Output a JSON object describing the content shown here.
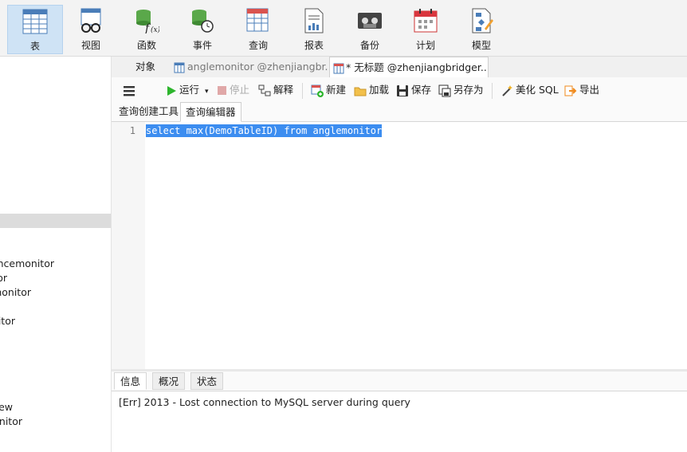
{
  "toolbar": {
    "buttons": [
      {
        "label": "表",
        "icon": "table-icon"
      },
      {
        "label": "视图",
        "icon": "view-icon"
      },
      {
        "label": "函数",
        "icon": "function-icon"
      },
      {
        "label": "事件",
        "icon": "event-icon"
      },
      {
        "label": "查询",
        "icon": "query-icon"
      },
      {
        "label": "报表",
        "icon": "report-icon"
      },
      {
        "label": "备份",
        "icon": "backup-icon"
      },
      {
        "label": "计划",
        "icon": "schedule-icon"
      },
      {
        "label": "模型",
        "icon": "model-icon"
      }
    ]
  },
  "left_pane": {
    "items": [
      "ncemonitor",
      "or",
      "monitor",
      "itor",
      "ew",
      "nitor"
    ]
  },
  "tabs": [
    "对象",
    "anglemonitor @zhenjiangbr...",
    "* 无标题 @zhenjiangbridger..."
  ],
  "query_toolbar": {
    "run": "运行",
    "stop": "停止",
    "explain": "解释",
    "new": "新建",
    "load": "加载",
    "save": "保存",
    "save_as": "另存为",
    "beautify": "美化 SQL",
    "export": "导出"
  },
  "sub_tabs": [
    "查询创建工具",
    "查询编辑器"
  ],
  "editor": {
    "line_number": "1",
    "code": "select max(DemoTableID) from anglemonitor"
  },
  "bottom_tabs": [
    "信息",
    "概况",
    "状态"
  ],
  "message": "[Err] 2013 - Lost connection to MySQL server during query",
  "colors": {
    "accent": "#3c8df0",
    "active_toolbar": "#cfe3f5",
    "run_green": "#2db52d",
    "export_orange": "#f08a1c"
  }
}
